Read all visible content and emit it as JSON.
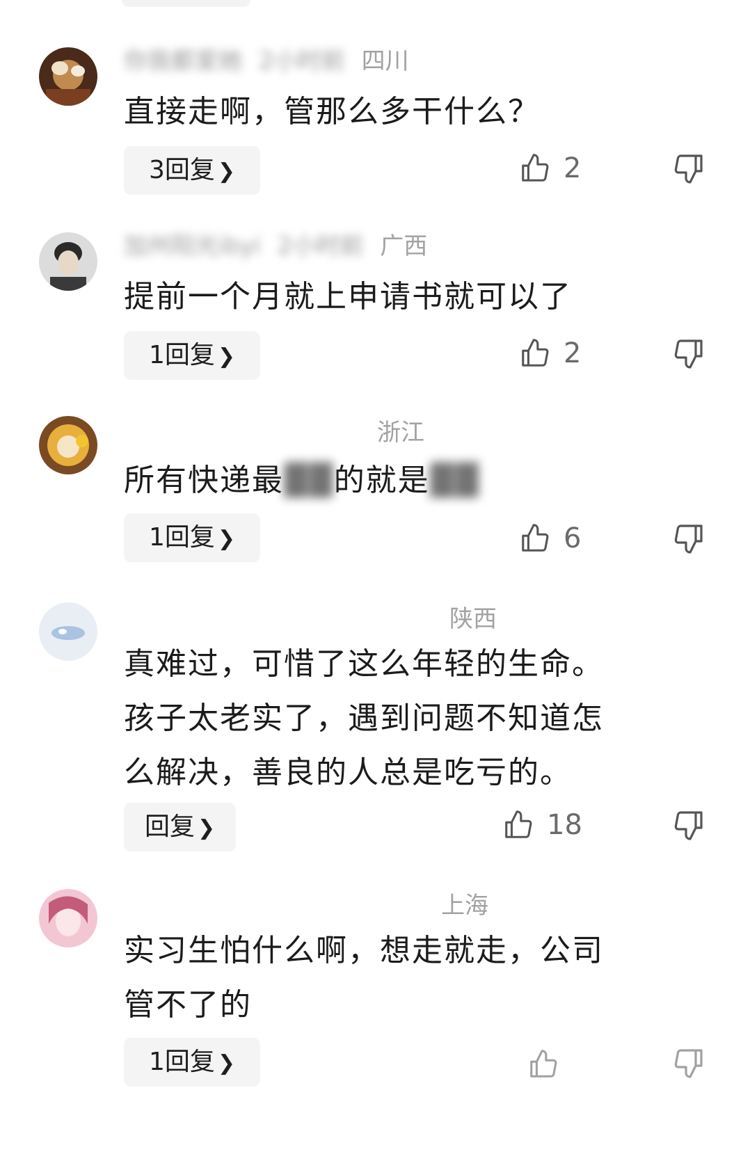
{
  "comments": [
    {
      "username": "你我都爱她",
      "time": "2小时前",
      "region": "四川",
      "content": "直接走啊，管那么多干什么？",
      "reply_label": "3回复",
      "likes": "2",
      "avatar_colors": [
        "#c08a50",
        "#4a2a1a"
      ]
    },
    {
      "username": "加州阳光ibyi",
      "time": "2小时前",
      "region": "广西",
      "content": "提前一个月就上申请书就可以了",
      "reply_label": "1回复",
      "likes": "2",
      "avatar_colors": [
        "#d8d8d8",
        "#2a2a2a"
      ]
    },
    {
      "username": "",
      "time": "",
      "region": "浙江",
      "content_pre": "所有快递最",
      "content_mid": "",
      "content_post": "的就是",
      "reply_label": "1回复",
      "likes": "6",
      "avatar_colors": [
        "#e7b03c",
        "#7a4a22"
      ]
    },
    {
      "username": "",
      "time": "",
      "region": "陕西",
      "content_lines": [
        "真难过，可惜了这么年轻的生命。",
        "孩子太老实了，遇到问题不知道怎",
        "么解决，善良的人总是吃亏的。"
      ],
      "reply_label": "回复",
      "likes": "18",
      "avatar_colors": [
        "#e9eef5",
        "#a9c3e0"
      ]
    },
    {
      "username": "",
      "time": "",
      "region": "上海",
      "content_lines": [
        "实习生怕什么啊，想走就走，公司",
        "管不了的"
      ],
      "reply_label": "1回复",
      "likes": "",
      "avatar_colors": [
        "#f3c6d3",
        "#c25c7a"
      ]
    }
  ],
  "icons": {
    "like": "thumbs-up-icon",
    "dislike": "thumbs-down-icon",
    "chevron": "chevron-right-icon"
  }
}
